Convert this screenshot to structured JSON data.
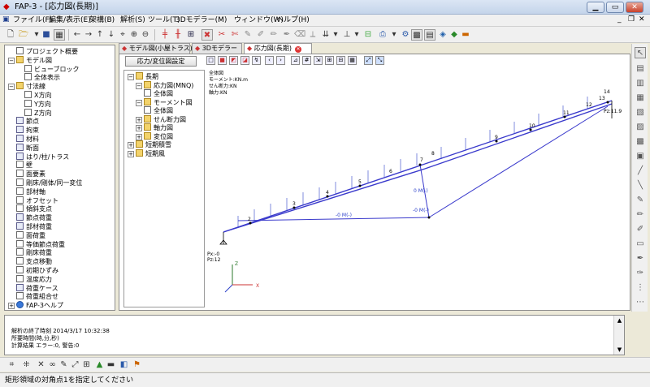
{
  "window": {
    "title": "FAP-3 - [応力図(長期)]"
  },
  "menu": [
    "ファイル(F)",
    "編集/表示(E)",
    "架構(B)",
    "解析(S)",
    "ツール(T)",
    "3Dモデラー(M)",
    "ウィンドウ(W)",
    "ヘルプ(H)"
  ],
  "left_tree": [
    {
      "label": "プロジェクト概要",
      "level": 1,
      "icon": "doc",
      "expander": ""
    },
    {
      "label": "モデル図",
      "level": 0,
      "icon": "folder",
      "expander": "−"
    },
    {
      "label": "ビューブロック",
      "level": 2,
      "icon": "doc",
      "expander": ""
    },
    {
      "label": "全体表示",
      "level": 2,
      "icon": "doc",
      "expander": ""
    },
    {
      "label": "寸法線",
      "level": 0,
      "icon": "folder",
      "expander": "−"
    },
    {
      "label": "X方向",
      "level": 2,
      "icon": "doc",
      "expander": ""
    },
    {
      "label": "Y方向",
      "level": 2,
      "icon": "doc",
      "expander": ""
    },
    {
      "label": "Z方向",
      "level": 2,
      "icon": "doc",
      "expander": ""
    },
    {
      "label": "節点",
      "level": 1,
      "icon": "grid",
      "expander": ""
    },
    {
      "label": "拘束",
      "level": 1,
      "icon": "grid",
      "expander": ""
    },
    {
      "label": "材料",
      "level": 1,
      "icon": "grid",
      "expander": ""
    },
    {
      "label": "断面",
      "level": 1,
      "icon": "grid",
      "expander": ""
    },
    {
      "label": "はり/柱/トラス",
      "level": 1,
      "icon": "grid",
      "expander": ""
    },
    {
      "label": "壁",
      "level": 1,
      "icon": "doc",
      "expander": ""
    },
    {
      "label": "面要素",
      "level": 1,
      "icon": "doc",
      "expander": ""
    },
    {
      "label": "剛床/剛体/同一変位",
      "level": 1,
      "icon": "doc",
      "expander": ""
    },
    {
      "label": "部材軸",
      "level": 1,
      "icon": "doc",
      "expander": ""
    },
    {
      "label": "オフセット",
      "level": 1,
      "icon": "doc",
      "expander": ""
    },
    {
      "label": "傾斜支点",
      "level": 1,
      "icon": "doc",
      "expander": ""
    },
    {
      "label": "節点荷重",
      "level": 1,
      "icon": "grid",
      "expander": ""
    },
    {
      "label": "部材荷重",
      "level": 1,
      "icon": "grid",
      "expander": ""
    },
    {
      "label": "面荷重",
      "level": 1,
      "icon": "doc",
      "expander": ""
    },
    {
      "label": "等価節点荷重",
      "level": 1,
      "icon": "doc",
      "expander": ""
    },
    {
      "label": "剛床荷重",
      "level": 1,
      "icon": "doc",
      "expander": ""
    },
    {
      "label": "支点移動",
      "level": 1,
      "icon": "doc",
      "expander": ""
    },
    {
      "label": "初期ひずみ",
      "level": 1,
      "icon": "doc",
      "expander": ""
    },
    {
      "label": "温度応力",
      "level": 1,
      "icon": "doc",
      "expander": ""
    },
    {
      "label": "荷重ケース",
      "level": 1,
      "icon": "grid",
      "expander": ""
    },
    {
      "label": "荷重組合せ",
      "level": 1,
      "icon": "doc",
      "expander": ""
    },
    {
      "label": "FAP-3ヘルプ",
      "level": 0,
      "icon": "help",
      "expander": "+"
    }
  ],
  "tabs": [
    {
      "label": "モデル図(小屋トラス)",
      "active": false
    },
    {
      "label": "3Dモデラー",
      "active": false
    },
    {
      "label": "応力図(長期)",
      "active": true
    }
  ],
  "stress_button_label": "応力/変位図設定",
  "result_tree": [
    {
      "label": "長期",
      "level": 0,
      "icon": "folder",
      "expander": "−"
    },
    {
      "label": "応力図(MNQ)",
      "level": 1,
      "icon": "folder",
      "expander": "−"
    },
    {
      "label": "全体図",
      "level": 2,
      "icon": "doc",
      "expander": ""
    },
    {
      "label": "モーメント図",
      "level": 1,
      "icon": "folder",
      "expander": "−"
    },
    {
      "label": "全体図",
      "level": 2,
      "icon": "doc",
      "expander": ""
    },
    {
      "label": "せん断力図",
      "level": 1,
      "icon": "folder",
      "expander": "+"
    },
    {
      "label": "軸力図",
      "level": 1,
      "icon": "folder",
      "expander": "+"
    },
    {
      "label": "変位図",
      "level": 1,
      "icon": "folder",
      "expander": "+"
    },
    {
      "label": "短期積雪",
      "level": 0,
      "icon": "folder",
      "expander": "+"
    },
    {
      "label": "短期風",
      "level": 0,
      "icon": "folder",
      "expander": "+"
    }
  ],
  "canvas": {
    "legend": [
      "全体図",
      "モーメント:KN.m",
      "せん断力:KN",
      "軸力:KN"
    ],
    "support_left": [
      "Px:-0",
      "Pz:12"
    ],
    "support_right": "Pz:11.9",
    "node_labels": [
      "2",
      "3",
      "4",
      "5",
      "6",
      "7",
      "8",
      "9",
      "10",
      "11",
      "12",
      "13",
      "14"
    ],
    "member_labels": [
      "-0 M(-)",
      "0 M(-)",
      "-0 M(-)"
    ],
    "axis_z": "Z",
    "axis_x": "X"
  },
  "log": [
    "解析の終了時刻 2014/3/17 10:32:38",
    "所要時間(時,分,秒)",
    "計算結果 エラー:0, 警告:0"
  ],
  "status": "矩形領域の対角点1を指定してください",
  "colors": {
    "diagram": "#2b3fc9",
    "member": "#3a3acc",
    "titlebar": "#c4d4ea"
  }
}
